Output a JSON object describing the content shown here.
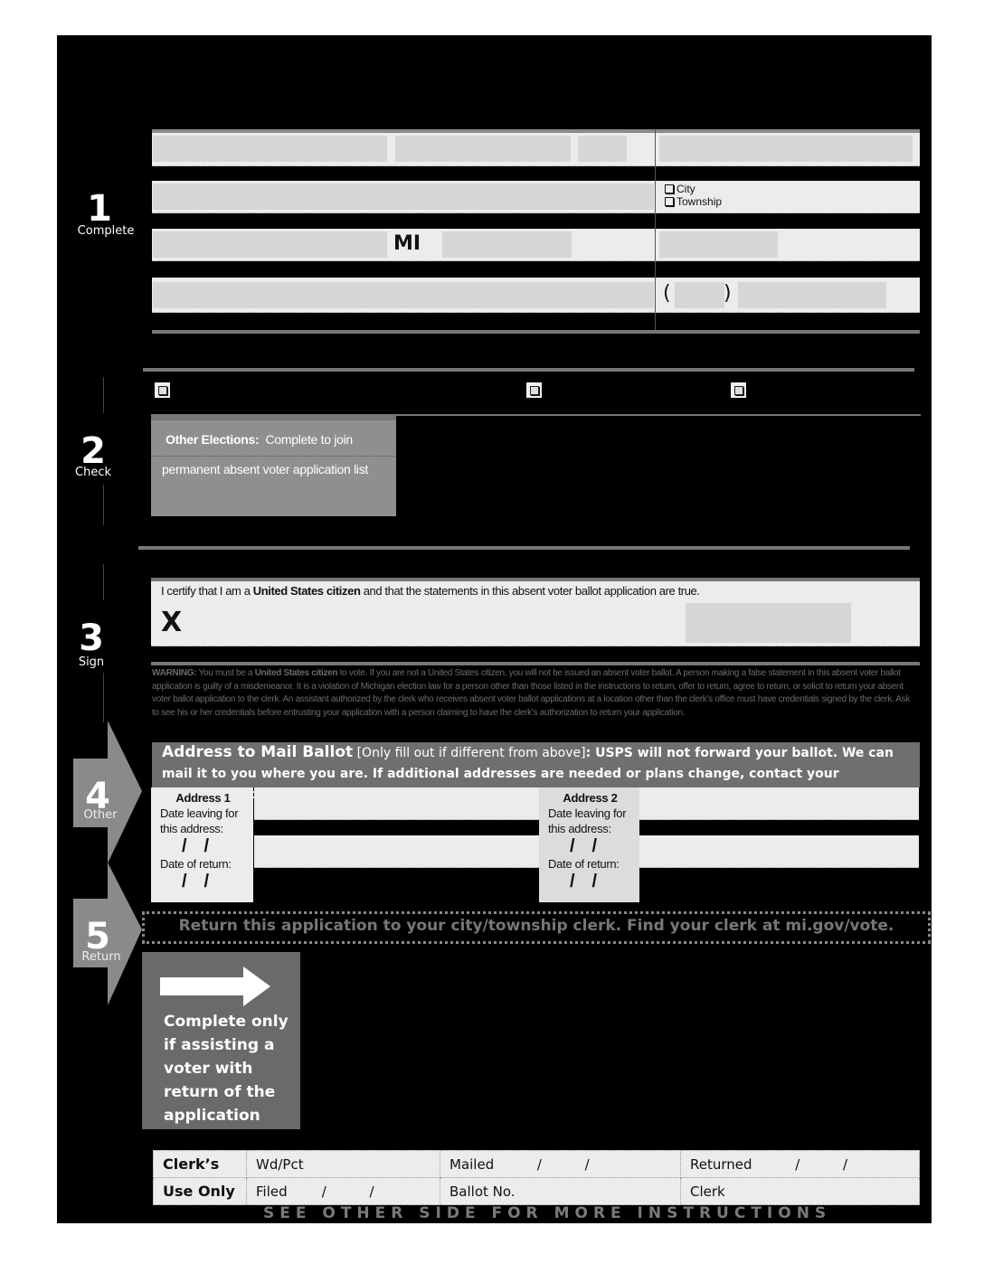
{
  "steps": [
    {
      "number": "1",
      "label": "Complete"
    },
    {
      "number": "2",
      "label": "Check"
    },
    {
      "number": "3",
      "label": "Sign"
    },
    {
      "number": "4",
      "label": "Other"
    },
    {
      "number": "5",
      "label": "Return"
    }
  ],
  "section1": {
    "state_value": "MI",
    "jurisdiction_options": [
      "City",
      "Township"
    ],
    "phone_open_paren": "(",
    "phone_close_paren": ")"
  },
  "section2": {
    "checkboxes_checked": [
      false,
      false,
      false
    ],
    "other_elections_title": "Other Elections:",
    "other_elections_text1": "Complete to join",
    "other_elections_text2": "permanent absent voter application list"
  },
  "section3": {
    "certify_pre": "I certify that I am a ",
    "certify_bold": "United States citizen",
    "certify_post": " and that the statements in this absent voter ballot application are true.",
    "signature_mark": "X",
    "warning_label": "WARNING:",
    "warning_pre": " You must be a ",
    "warning_bold": "United States citizen",
    "warning_text": " to vote.  If you are not a United States citizen, you will not be issued an absent voter ballot.  A person making a false statement in this absent voter ballot application is guilty of a misdemeanor.  It is a violation of Michigan election law for a person other than those listed in the instructions to return, offer to return, agree to return, or solicit to return your absent voter ballot application to the clerk.  An assistant authorized by the clerk who receives absent voter ballot applications at a location other than the clerk's office must have credentials signed by the clerk.  Ask to see his or her credentials before entrusting your application with a person claiming to have the clerk's authorization to return your application."
  },
  "section4": {
    "header_title": "Address to Mail Ballot",
    "header_bracket": " [Only fill out if different from above]",
    "header_colon": ":  ",
    "header_bold": "USPS will not forward your ballot. We can mail it to you where you are. If additional addresses are needed or plans change, contact your city/township clerk.",
    "addresses": [
      {
        "title": "Address 1",
        "leaving_label": "Date leaving for this address:",
        "leaving_date": "/ /",
        "return_label": "Date of return:",
        "return_date": "/ /"
      },
      {
        "title": "Address 2",
        "leaving_label": "Date leaving for this address:",
        "leaving_date": "/ /",
        "return_label": "Date of return:",
        "return_date": "/ /"
      }
    ]
  },
  "section5": {
    "return_text": "Return this application to your city/township clerk. Find your clerk at mi.gov/vote.",
    "assist_text": "Complete only if assisting a voter with return of the application"
  },
  "clerk_table": {
    "head_line1": "Clerk’s",
    "head_line2": "Use Only",
    "rows": [
      [
        "Wd/Pct",
        "Mailed          /          /",
        "Returned          /          /"
      ],
      [
        "Filed        /          /",
        "Ballot No.",
        "Clerk"
      ]
    ]
  },
  "footer": "SEE OTHER  SIDE FOR MORE INSTRUCTIONS"
}
